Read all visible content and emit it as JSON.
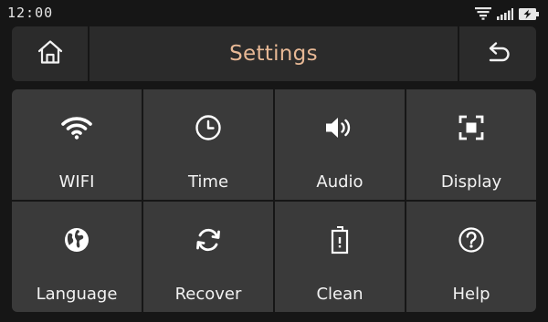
{
  "status_bar": {
    "time": "12:00",
    "icons": [
      "wifi-icon",
      "signal-icon",
      "battery-charging-icon"
    ]
  },
  "header": {
    "title": "Settings",
    "home_icon": "home-icon",
    "back_icon": "back-arrow-icon"
  },
  "colors": {
    "title": "#e7b895",
    "tile_bg": "#3a3a3a",
    "header_bg": "#2b2b2b",
    "page_bg": "#161616"
  },
  "tiles": [
    {
      "label": "WIFI",
      "icon": "wifi-icon"
    },
    {
      "label": "Time",
      "icon": "clock-icon"
    },
    {
      "label": "Audio",
      "icon": "speaker-icon"
    },
    {
      "label": "Display",
      "icon": "display-focus-icon"
    },
    {
      "label": "Language",
      "icon": "globe-icon"
    },
    {
      "label": "Recover",
      "icon": "refresh-icon"
    },
    {
      "label": "Clean",
      "icon": "trash-icon"
    },
    {
      "label": "Help",
      "icon": "help-icon"
    }
  ]
}
